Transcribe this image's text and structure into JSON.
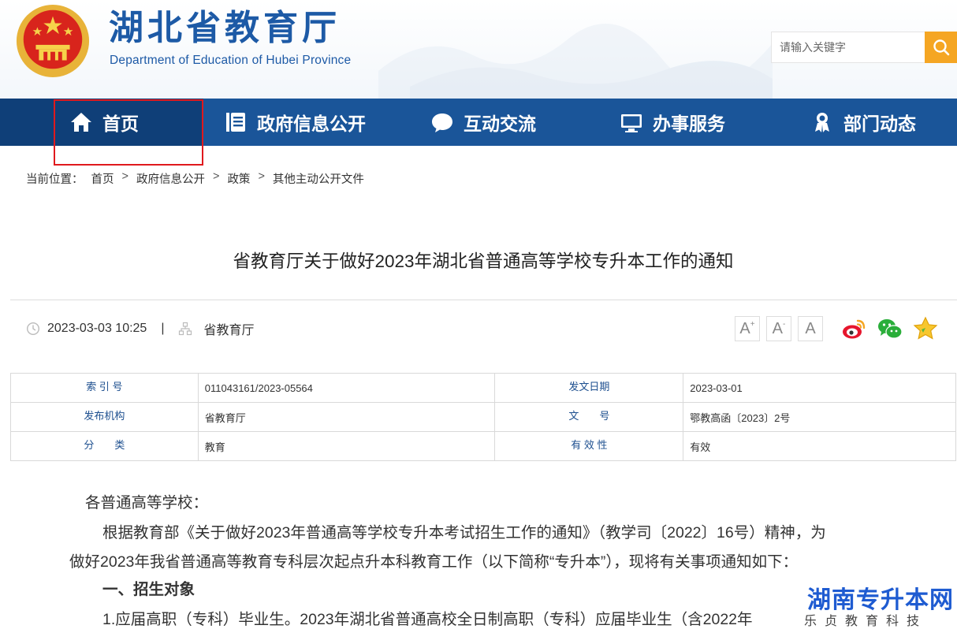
{
  "header": {
    "title": "湖北省教育厅",
    "subtitle": "Department of Education of Hubei Province",
    "search": {
      "placeholder": "请输入关键字"
    }
  },
  "nav": {
    "items": [
      {
        "label": "首页",
        "icon": "home-icon",
        "active": true
      },
      {
        "label": "政府信息公开",
        "icon": "document-list-icon"
      },
      {
        "label": "互动交流",
        "icon": "chat-bubble-icon"
      },
      {
        "label": "办事服务",
        "icon": "monitor-icon"
      },
      {
        "label": "部门动态",
        "icon": "award-person-icon"
      }
    ]
  },
  "breadcrumb": {
    "prefix": "当前位置：",
    "items": [
      "首页",
      "政府信息公开",
      "政策",
      "其他主动公开文件"
    ],
    "separator": ">"
  },
  "article": {
    "title": "省教育厅关于做好2023年湖北省普通高等学校专升本工作的通知",
    "datetime": "2023-03-03 10:25",
    "meta_separator": "|",
    "source": "省教育厅",
    "font_controls": [
      "A",
      "A",
      "A"
    ]
  },
  "info_table": {
    "rows": [
      {
        "k1": "索 引 号",
        "v1": "011043161/2023-05564",
        "k2": "发文日期",
        "v2": "2023-03-01"
      },
      {
        "k1": "发布机构",
        "v1": "省教育厅",
        "k2": "文　　号",
        "v2": "鄂教高函〔2023〕2号"
      },
      {
        "k1": "分　　类",
        "v1": "教育",
        "k2": "有 效 性",
        "v2": "有效"
      }
    ]
  },
  "body": {
    "greeting": "各普通高等学校：",
    "para1_line1": "根据教育部《关于做好2023年普通高等学校专升本考试招生工作的通知》（教学司〔2022〕16号）精神，为",
    "para1_line2": "做好2023年我省普通高等教育专科层次起点升本科教育工作（以下简称“专升本”），现将有关事项通知如下：",
    "section1": "一、招生对象",
    "item1": "1.应届高职（专科）毕业生。2023年湖北省普通高校全日制高职（专科）应届毕业生（含2022年"
  },
  "watermark": {
    "name": "湖南专升本网",
    "tagline": "乐贞教育科技"
  },
  "colors": {
    "brand_blue": "#1d5aa6",
    "nav_bg": "#1a5599",
    "nav_active": "#0f3f78",
    "search_button": "#f5a623",
    "highlight": "#e0191d"
  }
}
